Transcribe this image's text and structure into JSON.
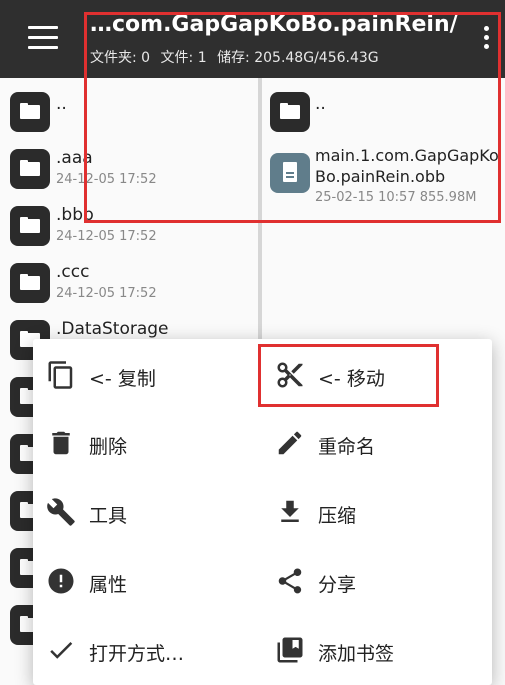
{
  "header": {
    "menu_icon": "hamburger-icon",
    "path": "…com.GapGapKoBo.painRein/",
    "folders": "文件夹: 0",
    "files": "文件: 1",
    "storage": "储存: 205.48G/456.43G",
    "more_icon": "more-vert-icon"
  },
  "left_pane": {
    "items": [
      {
        "name": "..",
        "meta": ""
      },
      {
        "name": ".aaa",
        "meta": "24-12-05 17:52"
      },
      {
        "name": ".bbb",
        "meta": "24-12-05 17:52"
      },
      {
        "name": ".ccc",
        "meta": "24-12-05 17:52"
      },
      {
        "name": ".DataStorage",
        "meta": ""
      }
    ]
  },
  "right_pane": {
    "items": [
      {
        "name": "..",
        "meta": ""
      },
      {
        "name": "main.1.com.GapGapKoBo.painRein.obb",
        "meta": "25-02-15 10:57  855.98M"
      }
    ]
  },
  "menu": {
    "items": [
      {
        "label": "<- 复制",
        "icon": "copy-icon"
      },
      {
        "label": "<- 移动",
        "icon": "scissors-icon"
      },
      {
        "label": "删除",
        "icon": "trash-icon"
      },
      {
        "label": "重命名",
        "icon": "pencil-icon"
      },
      {
        "label": "工具",
        "icon": "wrench-icon"
      },
      {
        "label": "压缩",
        "icon": "download-icon"
      },
      {
        "label": "属性",
        "icon": "info-icon"
      },
      {
        "label": "分享",
        "icon": "share-icon"
      },
      {
        "label": "打开方式…",
        "icon": "check-icon"
      },
      {
        "label": "添加书签",
        "icon": "bookmark-icon"
      }
    ]
  },
  "colors": {
    "appbar": "#2f2f2f",
    "folder_icon": "#2b2b2b",
    "file_icon": "#607d8b",
    "highlight": "#e03030"
  }
}
